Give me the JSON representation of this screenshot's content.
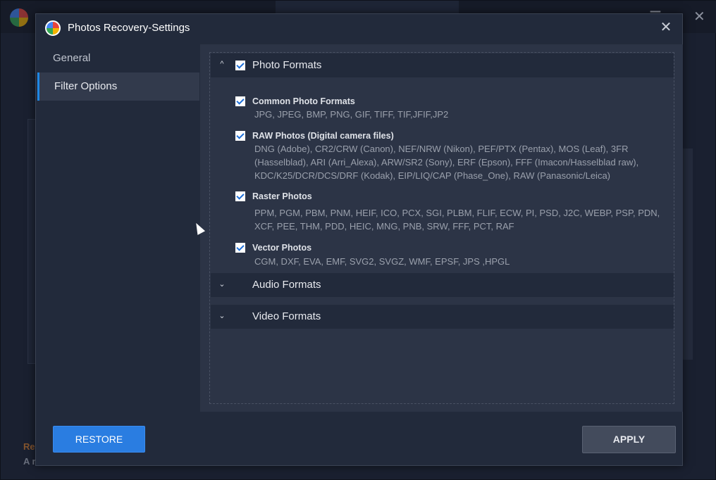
{
  "background_app": {
    "footer_line1": "Re",
    "footer_line2": "A r"
  },
  "dialog": {
    "title": "Photos Recovery-Settings",
    "close_glyph": "✕"
  },
  "sidebar": {
    "items": [
      {
        "label": "General",
        "active": false
      },
      {
        "label": "Filter Options",
        "active": true
      }
    ]
  },
  "sections": {
    "photo": {
      "label": "Photo Formats",
      "expanded": true,
      "checked": true
    },
    "audio": {
      "label": "Audio Formats",
      "expanded": false
    },
    "video": {
      "label": "Video Formats",
      "expanded": false
    }
  },
  "photo_options": [
    {
      "title": "Common Photo Formats",
      "checked": true,
      "formats": "JPG, JPEG, BMP, PNG, GIF, TIFF, TIF,JFIF,JP2"
    },
    {
      "title": "RAW Photos (Digital camera files)",
      "checked": true,
      "formats": "DNG (Adobe), CR2/CRW (Canon), NEF/NRW (Nikon), PEF/PTX (Pentax), MOS (Leaf), 3FR (Hasselblad), ARI (Arri_Alexa), ARW/SR2 (Sony), ERF (Epson), FFF (Imacon/Hasselblad raw), KDC/K25/DCR/DCS/DRF (Kodak),  EIP/LIQ/CAP (Phase_One), RAW (Panasonic/Leica)"
    },
    {
      "title": "Raster Photos",
      "checked": true,
      "formats": "PPM, PGM, PBM, PNM, HEIF, ICO, PCX, SGI, PLBM, FLIF, ECW, PI, PSD, J2C, WEBP, PSP, PDN, XCF, PEE, THM, PDD, HEIC, MNG, PNB, SRW, FFF, PCT, RAF"
    },
    {
      "title": "Vector Photos",
      "checked": true,
      "formats": "CGM, DXF, EVA, EMF, SVG2, SVGZ, WMF, EPSF, JPS ,HPGL"
    }
  ],
  "buttons": {
    "restore": "RESTORE",
    "apply": "APPLY"
  },
  "colors": {
    "accent": "#2a7de1",
    "dialog_bg": "#222a3b",
    "content_bg": "#2c3446"
  }
}
